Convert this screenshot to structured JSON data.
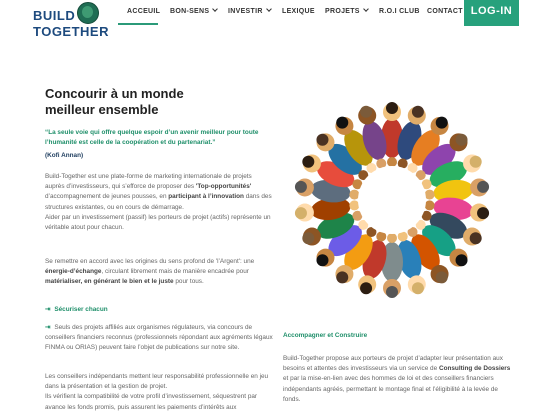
{
  "brand": {
    "line1": "BUILD",
    "line2": "TOGETHER"
  },
  "nav": {
    "items": [
      {
        "label": "ACCEUIL",
        "active": true,
        "dropdown": false
      },
      {
        "label": "BON-SENS",
        "active": false,
        "dropdown": true
      },
      {
        "label": "INVESTIR",
        "active": false,
        "dropdown": true
      },
      {
        "label": "LEXIQUE",
        "active": false,
        "dropdown": false
      },
      {
        "label": "PROJETS",
        "active": false,
        "dropdown": true
      },
      {
        "label": "R.O.I CLUB",
        "active": false,
        "dropdown": false
      },
      {
        "label": "CONTACT",
        "active": false,
        "dropdown": false
      }
    ],
    "login": "LOG-IN"
  },
  "main": {
    "title_line1": "Concourir à un monde",
    "title_line2": "meilleur ensemble",
    "quote": "“La seule voie qui offre quelque espoir d’un avenir meilleur pour toute l’humanité est celle de la coopération et du partenariat.”",
    "quote_author": "(Kofi Annan)",
    "p1_a": "Build-Together est une plate-forme de marketing internationale de projets auprès d’investisseurs, qui s’efforce de proposer des ",
    "p1_b": "'Top-opportunités'",
    "p1_c": " d’accompagnement de jeunes pousses, en ",
    "p1_d": "participant à l’innovation",
    "p1_e": " dans des structures existantes, ou en cours de démarrage.",
    "p1_f": "Aider par un investissement (passif) les porteurs de projet (actifs) représente un véritable atout pour chacun.",
    "p2_a": "Se remettre en accord avec les origines du sens profond de 'l’Argent': une ",
    "p2_b": "énergie-d’échange",
    "p2_c": ", circulant librement mais de manière encadrée pour ",
    "p2_d": "matérialiser, en générant le bien et le juste",
    "p2_e": " pour tous.",
    "secure_head": "Sécuriser chacun",
    "p3": "Seuls des projets affiliés aux organismes régulateurs, via concours de conseillers financiers reconnus (professionnels répondant aux agréments légaux FINMA ou ORIAS) peuvent faire l’objet de publications sur notre site.",
    "p4_a": "Les conseillers indépendants mettent leur responsabilité professionnelle en jeu dans la présentation et la gestion de projet.",
    "p4_b": "Ils vérifient la compatibilité de votre profil d’investissement, séquestrent par avance les fonds promis, puis assurent les paiements d’intérêts aux"
  },
  "right": {
    "head": "Accompagner et Construire",
    "p_a": "Build-Together propose aux porteurs de projet d’adapter leur présentation aux besoins et attentes des investisseurs via un service de ",
    "p_b": "Consulting de Dossiers",
    "p_c": " et par la mise-en-lien avec des hommes de loi et des conseillers financiers indépendants agréés, permettant le montage final et l’éligibilité à la levée de fonds."
  },
  "image": {
    "name": "circle-of-hands-photo"
  },
  "colors": {
    "accent": "#27a17c",
    "brand": "#1d4a7e"
  }
}
